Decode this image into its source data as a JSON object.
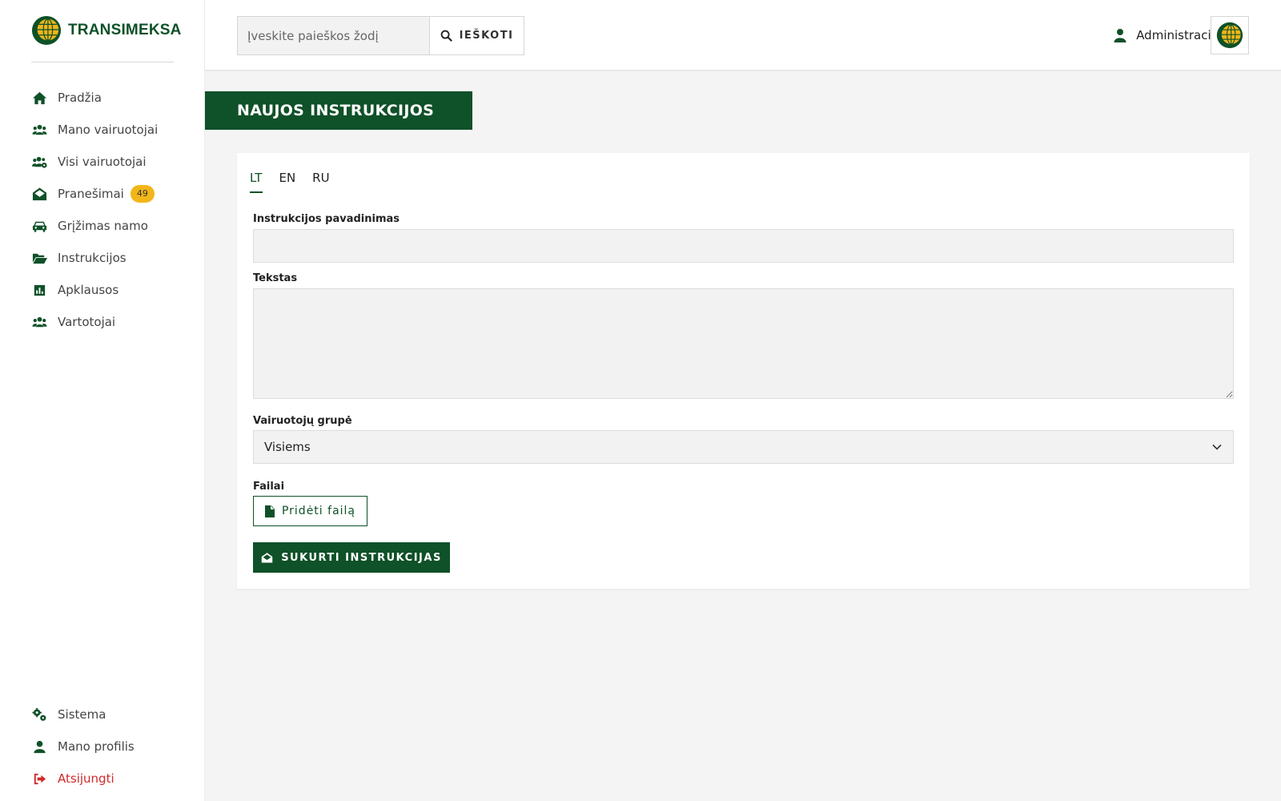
{
  "brand": {
    "name": "TRANSIMEKSA",
    "primary_color": "#0f5128",
    "accent_color": "#f2b619"
  },
  "sidebar": {
    "items": [
      {
        "label": "Pradžia",
        "icon": "home-icon"
      },
      {
        "label": "Mano vairuotojai",
        "icon": "users-icon"
      },
      {
        "label": "Visi vairuotojai",
        "icon": "users-cog-icon"
      },
      {
        "label": "Pranešimai",
        "icon": "envelope-open-icon",
        "badge": "49"
      },
      {
        "label": "Grįžimas namo",
        "icon": "car-icon"
      },
      {
        "label": "Instrukcijos",
        "icon": "folder-open-icon"
      },
      {
        "label": "Apklausos",
        "icon": "poll-icon"
      },
      {
        "label": "Vartotojai",
        "icon": "users-icon"
      }
    ],
    "bottom_items": [
      {
        "label": "Sistema",
        "icon": "cogs-icon"
      },
      {
        "label": "Mano profilis",
        "icon": "user-icon"
      },
      {
        "label": "Atsijungti",
        "icon": "sign-out-icon",
        "color": "#d12a2a"
      }
    ]
  },
  "header": {
    "search": {
      "placeholder": "Įveskite paieškos žodį",
      "button_label": "IEŠKOTI"
    },
    "user_label": "Administracija"
  },
  "page": {
    "title": "NAUJOS INSTRUKCIJOS",
    "tabs": [
      "LT",
      "EN",
      "RU"
    ],
    "active_tab": "LT",
    "form": {
      "title_label": "Instrukcijos pavadinimas",
      "title_value": "",
      "text_label": "Tekstas",
      "text_value": "",
      "group_label": "Vairuotojų grupė",
      "group_value": "Visiems",
      "files_label": "Failai",
      "add_file_label": "Pridėti failą",
      "submit_label": "SUKURTI INSTRUKCIJAS"
    }
  }
}
